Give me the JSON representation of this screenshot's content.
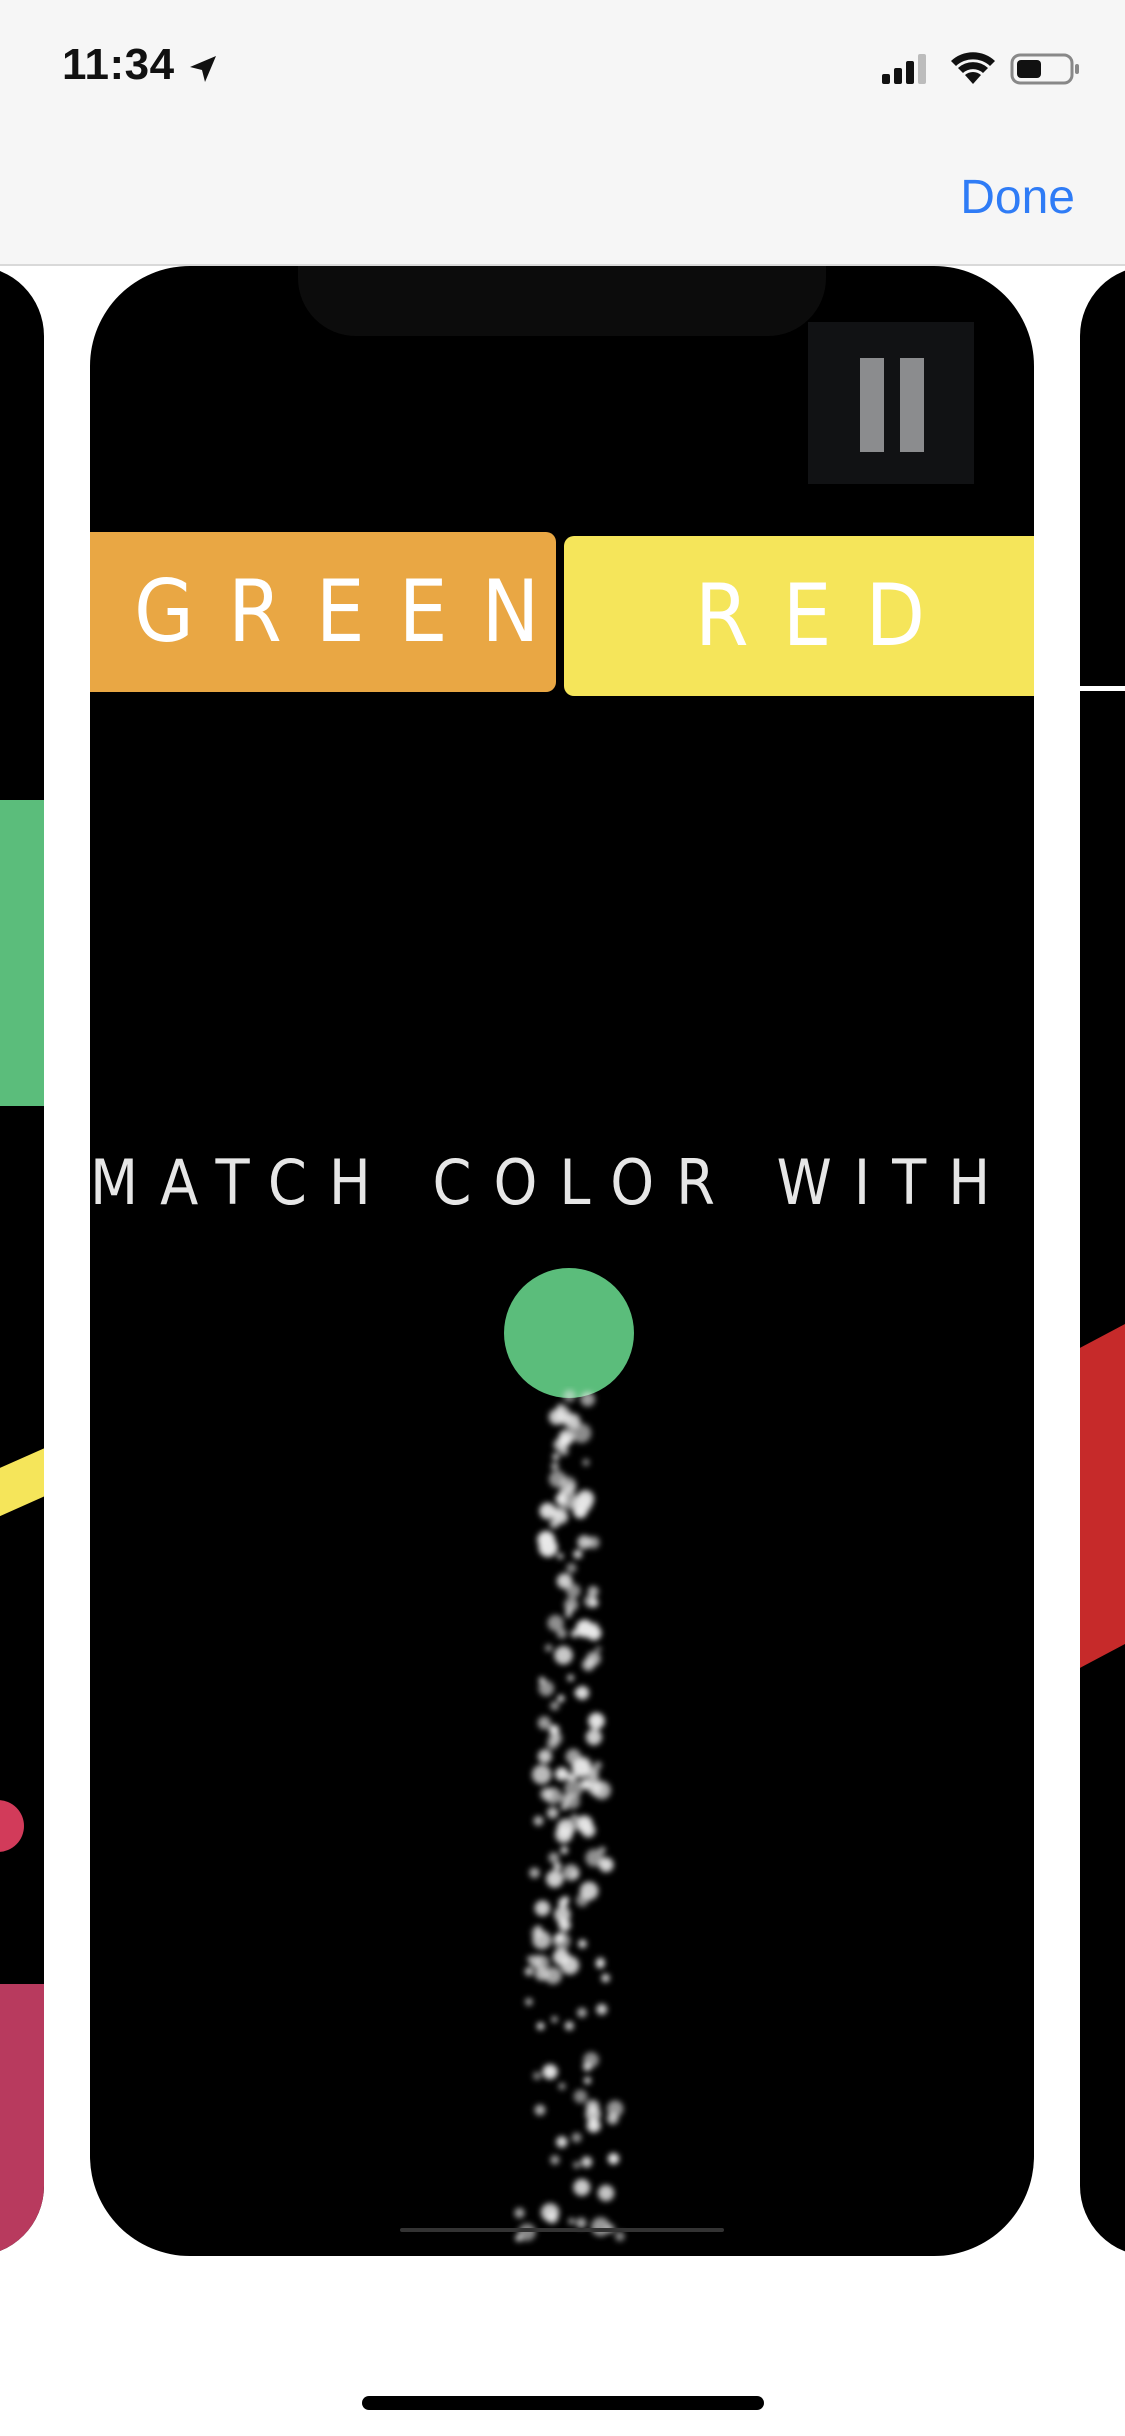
{
  "status_bar": {
    "time": "11:34",
    "icons": [
      "location-arrow-icon",
      "cellular-signal-icon",
      "wifi-icon",
      "battery-icon"
    ]
  },
  "nav": {
    "done_label": "Done",
    "accent_color": "#2f7cf6"
  },
  "game": {
    "left_button_text": "GREEN",
    "right_button_text": "RED",
    "left_button_color": "#e9a744",
    "right_button_color": "#f5e55a",
    "instruction": "MATCH COLOR WITH TEXT",
    "ball_color": "#5bbd7b",
    "pause_icon": "pause-icon"
  },
  "side_cards": {
    "left_colors": [
      "#5bbd7b",
      "#f5e55a",
      "#d23b5a",
      "#b83a5e"
    ],
    "right_colors": [
      "#c62a2a",
      "#ffffff"
    ]
  }
}
